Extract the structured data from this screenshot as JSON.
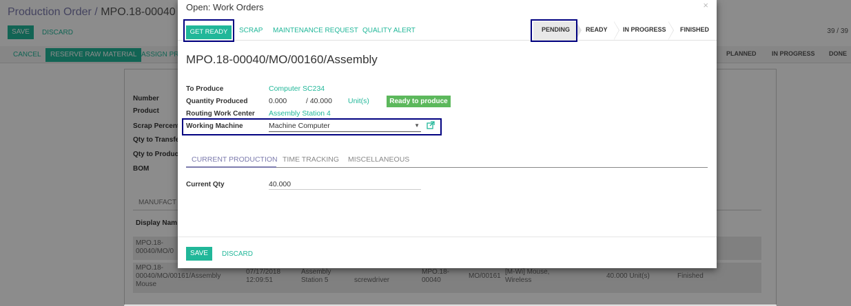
{
  "background": {
    "breadcrumb_parent": "Production Order /",
    "breadcrumb_current": "MPO.18-00040",
    "save_label": "SAVE",
    "discard_label": "DISCARD",
    "pager": "39 / 39",
    "actions": {
      "cancel": "CANCEL",
      "reserve": "RESERVE RAW MATERIAL",
      "assign": "ASSIGN PR"
    },
    "stages": {
      "planned": "PLANNED",
      "in_progress": "IN PROGRESS",
      "done": "DONE"
    },
    "fields": {
      "number": "Number",
      "product": "Product",
      "scrap": "Scrap Percent",
      "qty_transfer": "Qty to Transfe",
      "qty_produce": "Qty to Produc",
      "bom": "BOM"
    },
    "tab": "MANUFACT",
    "col_display_name": "Display Nam",
    "rows": [
      {
        "name": "MPO.18-00040/MO/0",
        "rest": ""
      },
      {
        "name": "MPO.18-00040/MO/00161/Assembly Mouse",
        "date": "07/17/2018 12:09:51",
        "wc": "Assembly Station 5",
        "machine": "screwdriver",
        "prod": "MPO.18-00040",
        "mo": "MO/00161",
        "product": "[M-Wi] Mouse, Wireless",
        "qty": "40.000 Unit(s)",
        "state": "Finished"
      }
    ]
  },
  "modal": {
    "title": "Open: Work Orders",
    "close_icon": "×",
    "buttons": {
      "get_ready": "GET READY",
      "scrap": "SCRAP",
      "maintenance": "MAINTENANCE REQUEST",
      "quality": "QUALITY ALERT"
    },
    "stages": {
      "pending": "PENDING",
      "ready": "READY",
      "in_progress": "IN PROGRESS",
      "finished": "FINISHED"
    },
    "name": "MPO.18-00040/MO/00160/Assembly",
    "fields": {
      "to_produce_label": "To Produce",
      "to_produce_value": "Computer SC234",
      "qty_produced_label": "Quantity Produced",
      "qty_produced_value": "0.000",
      "qty_total": "/ 40.000",
      "qty_unit": "Unit(s)",
      "ready_badge": "Ready to produce",
      "routing_label": "Routing Work Center",
      "routing_value": "Assembly Station 4",
      "machine_label": "Working Machine",
      "machine_value": "Machine Computer"
    },
    "tabs": {
      "current_production": "CURRENT PRODUCTION",
      "time_tracking": "TIME TRACKING",
      "misc": "MISCELLANEOUS"
    },
    "current_qty_label": "Current Qty",
    "current_qty_value": "40.000",
    "footer": {
      "save": "SAVE",
      "discard": "DISCARD"
    }
  },
  "colors": {
    "accent": "#21b799",
    "brand": "#7C7BAD",
    "highlight": "#000080",
    "badge": "#5cb85c"
  },
  "icons": {
    "external_link": "external-link-icon",
    "dropdown": "caret-down-icon"
  }
}
